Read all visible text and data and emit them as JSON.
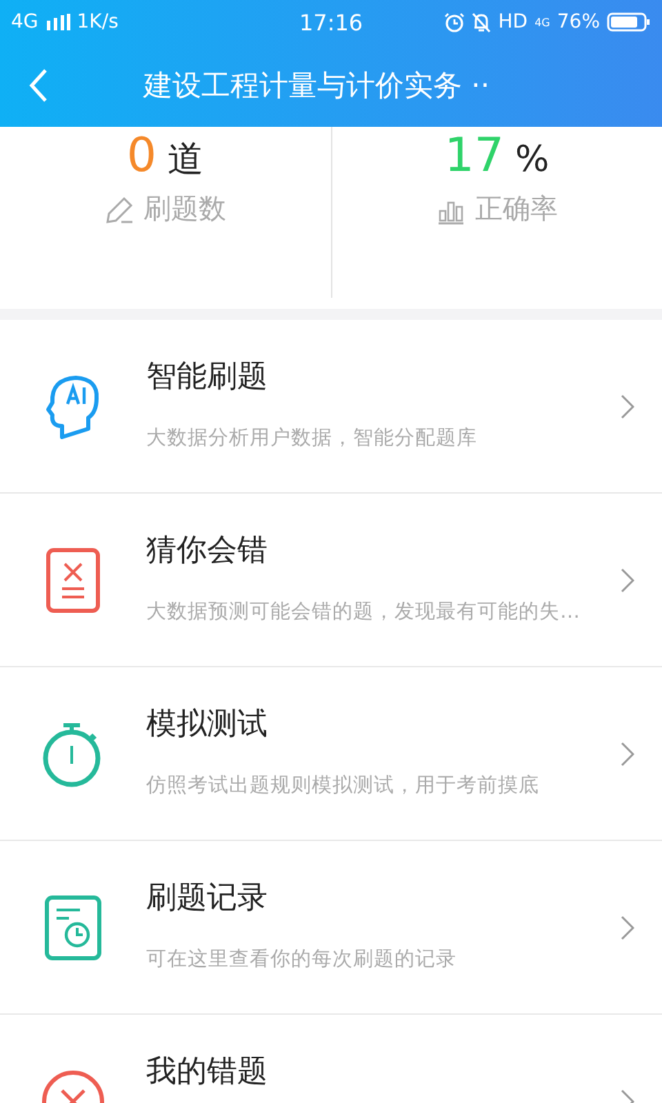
{
  "status_bar": {
    "network": "4G",
    "speed": "1K/s",
    "time": "17:16",
    "hd": "HD",
    "network_small": "4G",
    "battery": "76%"
  },
  "header": {
    "title": "建设工程计量与计价实务 ··"
  },
  "stats": [
    {
      "value": "0",
      "unit": "道",
      "label": "刷题数",
      "kind": "count",
      "color": "#f5892a"
    },
    {
      "value": "17",
      "unit": "%",
      "label": "正确率",
      "kind": "rate",
      "color": "#2fd36a"
    }
  ],
  "menu": [
    {
      "title": "智能刷题",
      "subtitle": "大数据分析用户数据，智能分配题库",
      "kind": "ai"
    },
    {
      "title": "猜你会错",
      "subtitle": "大数据预测可能会错的题，发现最有可能的失…",
      "kind": "guess"
    },
    {
      "title": "模拟测试",
      "subtitle": "仿照考试出题规则模拟测试，用于考前摸底",
      "kind": "timer"
    },
    {
      "title": "刷题记录",
      "subtitle": "可在这里查看你的每次刷题的记录",
      "kind": "record"
    },
    {
      "title": "我的错题",
      "kind": "wrong"
    }
  ]
}
